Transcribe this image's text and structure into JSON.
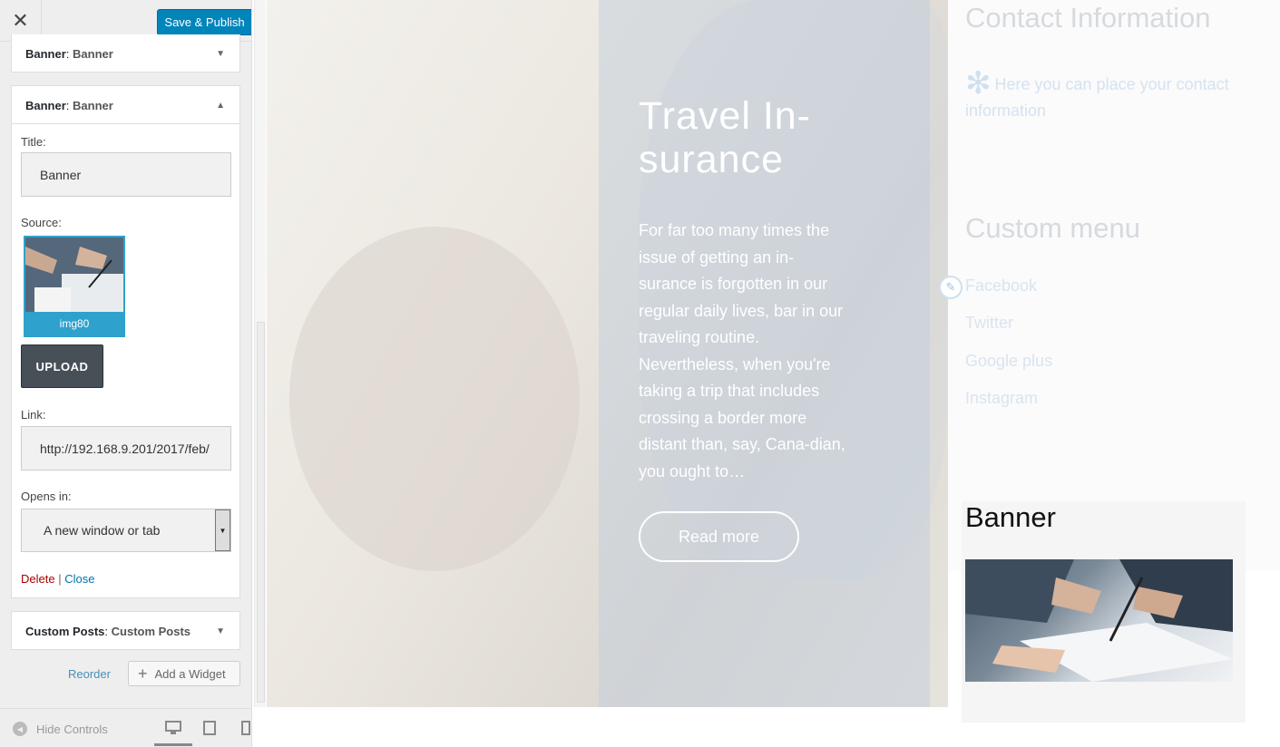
{
  "topbar": {
    "close_label": "✕",
    "save_label": "Save & Publish"
  },
  "widgets": [
    {
      "type": "Banner",
      "title": "Banner",
      "state": "collapsed"
    },
    {
      "type": "Banner",
      "title": "Banner",
      "state": "expanded"
    },
    {
      "type": "Custom Posts",
      "title": "Custom Posts",
      "state": "collapsed"
    }
  ],
  "form": {
    "title_label": "Title:",
    "title_value": "Banner",
    "source_label": "Source:",
    "image_caption": "img80",
    "upload_label": "UPLOAD",
    "link_label": "Link:",
    "link_value": "http://192.168.9.201/2017/feb/",
    "opens_label": "Opens in:",
    "opens_value": "A new window or tab",
    "delete_label": "Delete",
    "separator": "|",
    "close_label": "Close"
  },
  "actions": {
    "reorder_label": "Reorder",
    "add_widget_label": "Add a Widget"
  },
  "bottom": {
    "hide_controls_label": "Hide Controls"
  },
  "preview": {
    "hero_title": "Travel In-surance",
    "hero_text": "For far too many times the issue of getting an in-surance is forgotten in our regular daily lives, bar in our traveling routine. Nevertheless, when you're taking a trip that includes crossing a border more distant than, say, Cana-dian, you ought to…",
    "read_more_label": "Read more",
    "contact_heading": "Contact Information",
    "contact_text": "Here you can place your contact information",
    "menu_heading": "Custom menu",
    "menu_items": [
      "Facebook",
      "Twitter",
      "Google plus",
      "Instagram"
    ],
    "banner_heading": "Banner"
  },
  "colors": {
    "accent": "#0085ba",
    "link": "#0073aa",
    "delete": "#a00000",
    "upload": "#474f57"
  },
  "icons": [
    "close-icon",
    "triangle-down-icon",
    "triangle-up-icon",
    "plus-icon",
    "arrow-left-circle-icon",
    "desktop-icon",
    "tablet-icon",
    "mobile-icon",
    "gear-icon",
    "pencil-icon"
  ]
}
